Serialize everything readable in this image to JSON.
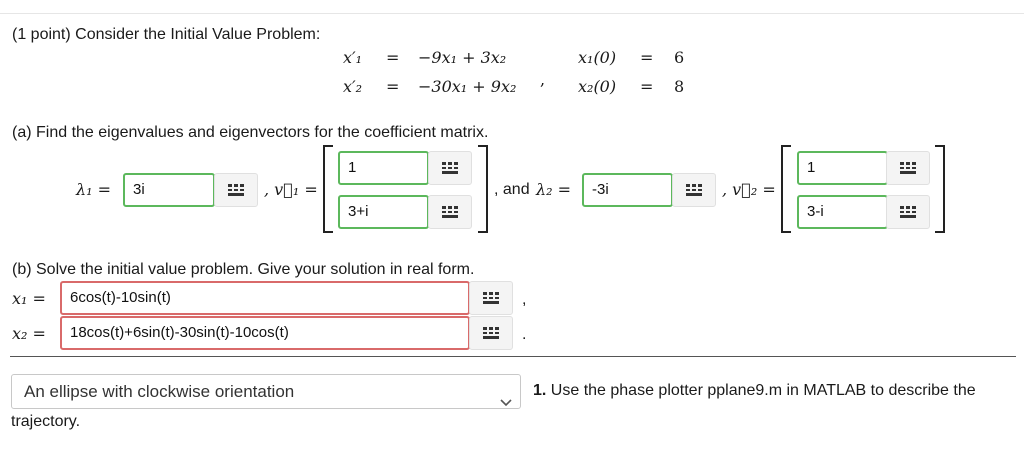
{
  "header": {
    "points": "(1 point)",
    "prompt": "Consider the Initial Value Problem:"
  },
  "ivp": {
    "lhs1": "x′₁",
    "lhs2": "x′₂",
    "eq": "=",
    "rhs1": "−9x₁ + 3x₂",
    "rhs2": "−30x₁ + 9x₂",
    "comma": ",",
    "ic1_lhs": "x₁(0)",
    "ic2_lhs": "x₂(0)",
    "ic1_val": "6",
    "ic2_val": "8"
  },
  "part_a": {
    "prompt": "(a) Find the eigenvalues and eigenvectors for the coefficient matrix.",
    "lambda1_label": "λ₁ =",
    "lambda1_value": "3i",
    "v1_label": ", v⃗₁ =",
    "v1_top": "1",
    "v1_bottom": "3+i",
    "and_label": ", and",
    "lambda2_label": "λ₂ =",
    "lambda2_value": "-3i",
    "v2_label": ", v⃗₂ =",
    "v2_top": "1",
    "v2_bottom": "3-i"
  },
  "part_b": {
    "prompt": "(b) Solve the initial value problem. Give your solution in real form.",
    "x1_label": "x₁ =",
    "x1_value": "6cos(t)-10sin(t)",
    "x1_trail": ",",
    "x2_label": "x₂ =",
    "x2_value": "18cos(t)+6sin(t)-30sin(t)-10cos(t)",
    "x2_trail": "."
  },
  "question1": {
    "selected": "An ellipse with clockwise orientation",
    "number": "1.",
    "text": "Use the phase plotter pplane9.m in MATLAB to describe the",
    "text_cont": "trajectory."
  },
  "icons": {
    "keyboard": "grid-keyboard-icon",
    "dropdown": "chevron-down-icon"
  },
  "colors": {
    "correct_border": "#5cb85c",
    "incorrect_border": "#d96a6a"
  }
}
